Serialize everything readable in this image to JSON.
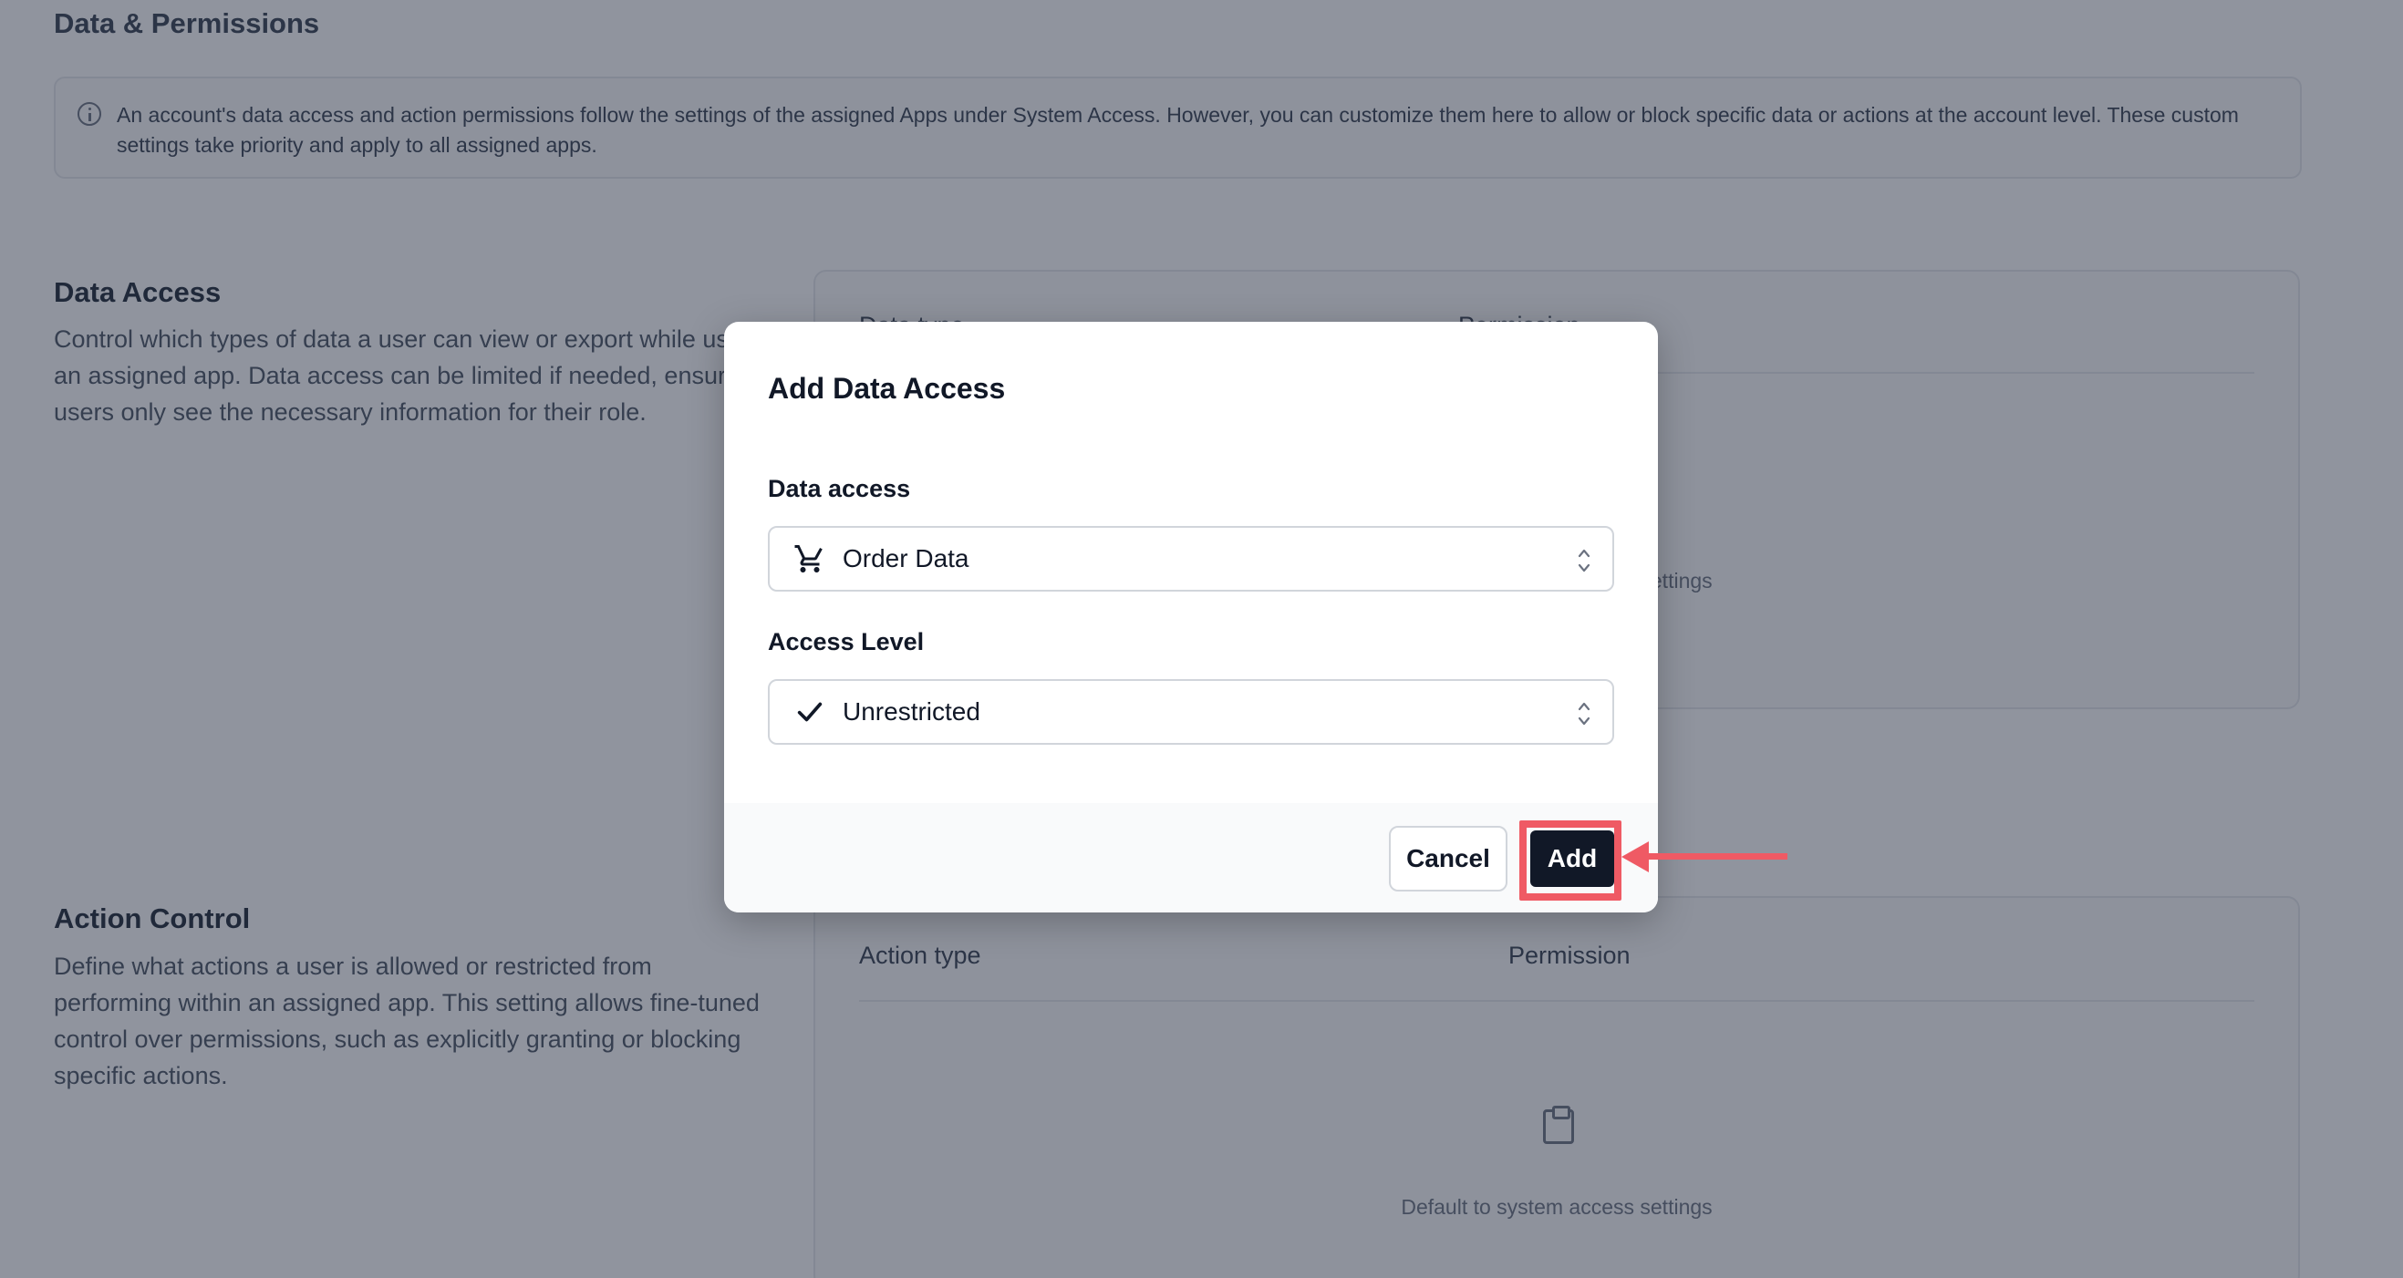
{
  "page": {
    "section_title": "Data & Permissions",
    "info_text": "An account's data access and action permissions follow the settings of the assigned Apps under System Access. However, you can customize them here to allow or block specific data or actions at the account level. These custom settings take priority and apply to all assigned apps."
  },
  "data_access": {
    "title": "Data Access",
    "description": "Control which types of data a user can view or export while using an assigned app. Data access can be limited if needed, ensuring users only see the necessary information for their role.",
    "col_type": "Data type",
    "col_permission": "Permission",
    "empty_text": "Default to system access settings"
  },
  "action_control": {
    "title": "Action Control",
    "description": "Define what actions a user is allowed or restricted from performing within an assigned app. This setting allows fine-tuned control over permissions, such as explicitly granting or blocking specific actions.",
    "col_type": "Action type",
    "col_permission": "Permission",
    "empty_text": "Default to system access settings"
  },
  "modal": {
    "title": "Add Data Access",
    "data_access_label": "Data access",
    "data_access_value": "Order Data",
    "data_access_icon": "cart-icon",
    "access_level_label": "Access Level",
    "access_level_value": "Unrestricted",
    "access_level_icon": "check-icon",
    "cancel_label": "Cancel",
    "add_label": "Add"
  },
  "colors": {
    "highlight": "#ef5a64",
    "primary_button": "#111827"
  }
}
